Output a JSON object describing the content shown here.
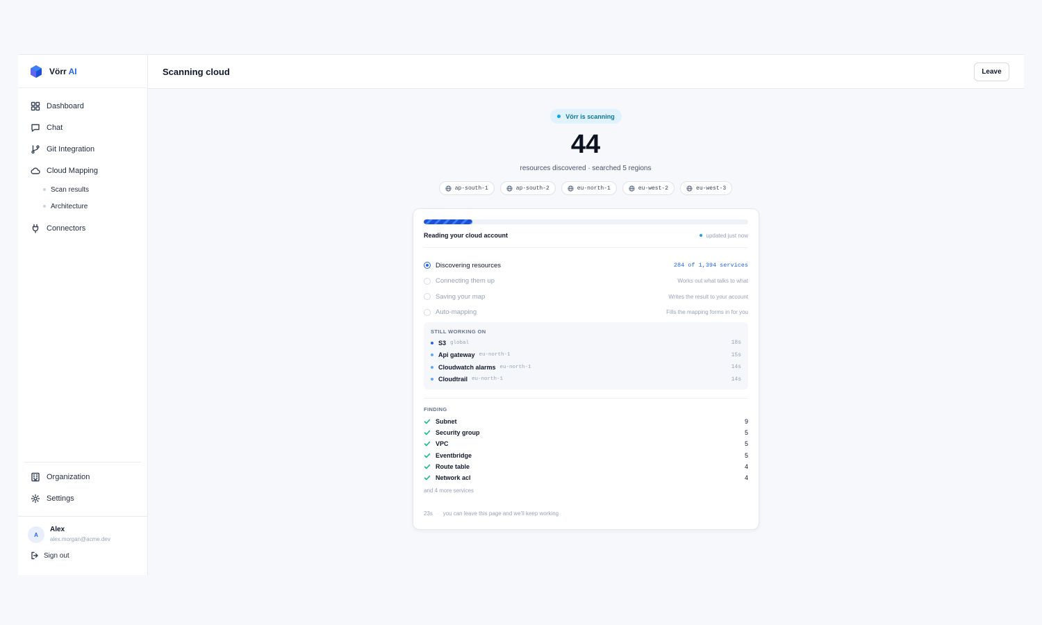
{
  "brand": {
    "name": "Vörr",
    "accent": "AI"
  },
  "sidebar": {
    "items": [
      {
        "label": "Dashboard"
      },
      {
        "label": "Chat"
      },
      {
        "label": "Git Integration"
      },
      {
        "label": "Cloud Mapping"
      },
      {
        "label": "Connectors"
      }
    ],
    "subitems": [
      {
        "label": "Scan results"
      },
      {
        "label": "Architecture"
      }
    ],
    "bottom": [
      {
        "label": "Organization"
      },
      {
        "label": "Settings"
      }
    ],
    "user": {
      "initial": "A",
      "name": "Alex",
      "email": "alex.morgan@acme.dev",
      "signout": "Sign out"
    }
  },
  "header": {
    "title": "Scanning cloud",
    "leave": "Leave"
  },
  "scan": {
    "status": "Vörr is scanning",
    "count": "44",
    "summary": "resources discovered · searched 5 regions",
    "regions": [
      "ap-south-1",
      "ap-south-2",
      "eu-north-1",
      "eu-west-2",
      "eu-west-3"
    ],
    "progress_fraction": 0.15,
    "card_title": "Reading your cloud account",
    "updated": "updated just now",
    "steps": [
      {
        "label": "Discovering resources",
        "detail": "284 of 1,394 services",
        "state": "active"
      },
      {
        "label": "Connecting them up",
        "detail": "Works out what talks to what",
        "state": "pending"
      },
      {
        "label": "Saving your map",
        "detail": "Writes the result to your account",
        "state": "pending"
      },
      {
        "label": "Auto-mapping",
        "detail": "Fills the mapping forms in for you",
        "state": "pending"
      }
    ],
    "working_heading": "STILL WORKING ON",
    "working": [
      {
        "name": "S3",
        "region": "global",
        "time": "18s"
      },
      {
        "name": "Api gateway",
        "region": "eu-north-1",
        "time": "15s"
      },
      {
        "name": "Cloudwatch alarms",
        "region": "eu-north-1",
        "time": "14s"
      },
      {
        "name": "Cloudtrail",
        "region": "eu-north-1",
        "time": "14s"
      }
    ],
    "finding_heading": "FINDING",
    "findings": [
      {
        "name": "Subnet",
        "count": "9"
      },
      {
        "name": "Security group",
        "count": "5"
      },
      {
        "name": "VPC",
        "count": "5"
      },
      {
        "name": "Eventbridge",
        "count": "5"
      },
      {
        "name": "Route table",
        "count": "4"
      },
      {
        "name": "Network acl",
        "count": "4"
      }
    ],
    "more": "and 4 more services",
    "elapsed": "23s",
    "footnote": "you can leave this page and we'll keep working"
  },
  "colors": {
    "accent": "#2563eb",
    "status_bg": "#e0f2fe",
    "check": "#10b981"
  }
}
